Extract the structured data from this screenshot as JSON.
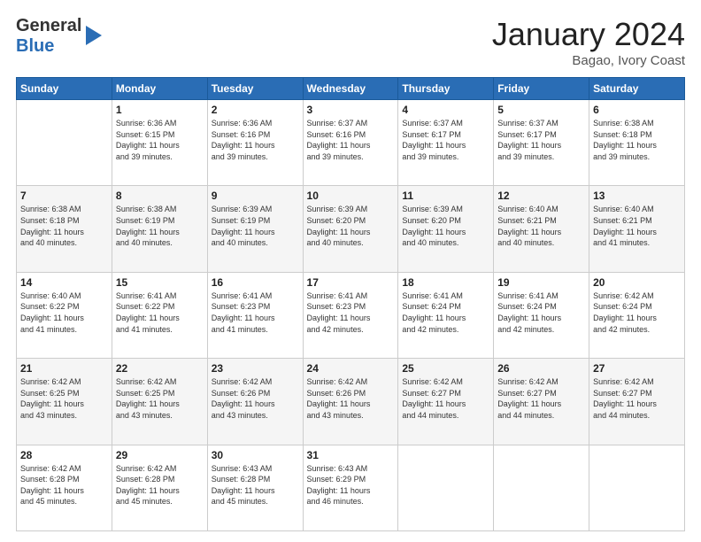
{
  "logo": {
    "line1": "General",
    "line2": "Blue"
  },
  "header": {
    "month": "January 2024",
    "location": "Bagao, Ivory Coast"
  },
  "weekdays": [
    "Sunday",
    "Monday",
    "Tuesday",
    "Wednesday",
    "Thursday",
    "Friday",
    "Saturday"
  ],
  "weeks": [
    [
      {
        "day": "",
        "info": ""
      },
      {
        "day": "1",
        "info": "Sunrise: 6:36 AM\nSunset: 6:15 PM\nDaylight: 11 hours\nand 39 minutes."
      },
      {
        "day": "2",
        "info": "Sunrise: 6:36 AM\nSunset: 6:16 PM\nDaylight: 11 hours\nand 39 minutes."
      },
      {
        "day": "3",
        "info": "Sunrise: 6:37 AM\nSunset: 6:16 PM\nDaylight: 11 hours\nand 39 minutes."
      },
      {
        "day": "4",
        "info": "Sunrise: 6:37 AM\nSunset: 6:17 PM\nDaylight: 11 hours\nand 39 minutes."
      },
      {
        "day": "5",
        "info": "Sunrise: 6:37 AM\nSunset: 6:17 PM\nDaylight: 11 hours\nand 39 minutes."
      },
      {
        "day": "6",
        "info": "Sunrise: 6:38 AM\nSunset: 6:18 PM\nDaylight: 11 hours\nand 39 minutes."
      }
    ],
    [
      {
        "day": "7",
        "info": "Sunrise: 6:38 AM\nSunset: 6:18 PM\nDaylight: 11 hours\nand 40 minutes."
      },
      {
        "day": "8",
        "info": "Sunrise: 6:38 AM\nSunset: 6:19 PM\nDaylight: 11 hours\nand 40 minutes."
      },
      {
        "day": "9",
        "info": "Sunrise: 6:39 AM\nSunset: 6:19 PM\nDaylight: 11 hours\nand 40 minutes."
      },
      {
        "day": "10",
        "info": "Sunrise: 6:39 AM\nSunset: 6:20 PM\nDaylight: 11 hours\nand 40 minutes."
      },
      {
        "day": "11",
        "info": "Sunrise: 6:39 AM\nSunset: 6:20 PM\nDaylight: 11 hours\nand 40 minutes."
      },
      {
        "day": "12",
        "info": "Sunrise: 6:40 AM\nSunset: 6:21 PM\nDaylight: 11 hours\nand 40 minutes."
      },
      {
        "day": "13",
        "info": "Sunrise: 6:40 AM\nSunset: 6:21 PM\nDaylight: 11 hours\nand 41 minutes."
      }
    ],
    [
      {
        "day": "14",
        "info": "Sunrise: 6:40 AM\nSunset: 6:22 PM\nDaylight: 11 hours\nand 41 minutes."
      },
      {
        "day": "15",
        "info": "Sunrise: 6:41 AM\nSunset: 6:22 PM\nDaylight: 11 hours\nand 41 minutes."
      },
      {
        "day": "16",
        "info": "Sunrise: 6:41 AM\nSunset: 6:23 PM\nDaylight: 11 hours\nand 41 minutes."
      },
      {
        "day": "17",
        "info": "Sunrise: 6:41 AM\nSunset: 6:23 PM\nDaylight: 11 hours\nand 42 minutes."
      },
      {
        "day": "18",
        "info": "Sunrise: 6:41 AM\nSunset: 6:24 PM\nDaylight: 11 hours\nand 42 minutes."
      },
      {
        "day": "19",
        "info": "Sunrise: 6:41 AM\nSunset: 6:24 PM\nDaylight: 11 hours\nand 42 minutes."
      },
      {
        "day": "20",
        "info": "Sunrise: 6:42 AM\nSunset: 6:24 PM\nDaylight: 11 hours\nand 42 minutes."
      }
    ],
    [
      {
        "day": "21",
        "info": "Sunrise: 6:42 AM\nSunset: 6:25 PM\nDaylight: 11 hours\nand 43 minutes."
      },
      {
        "day": "22",
        "info": "Sunrise: 6:42 AM\nSunset: 6:25 PM\nDaylight: 11 hours\nand 43 minutes."
      },
      {
        "day": "23",
        "info": "Sunrise: 6:42 AM\nSunset: 6:26 PM\nDaylight: 11 hours\nand 43 minutes."
      },
      {
        "day": "24",
        "info": "Sunrise: 6:42 AM\nSunset: 6:26 PM\nDaylight: 11 hours\nand 43 minutes."
      },
      {
        "day": "25",
        "info": "Sunrise: 6:42 AM\nSunset: 6:27 PM\nDaylight: 11 hours\nand 44 minutes."
      },
      {
        "day": "26",
        "info": "Sunrise: 6:42 AM\nSunset: 6:27 PM\nDaylight: 11 hours\nand 44 minutes."
      },
      {
        "day": "27",
        "info": "Sunrise: 6:42 AM\nSunset: 6:27 PM\nDaylight: 11 hours\nand 44 minutes."
      }
    ],
    [
      {
        "day": "28",
        "info": "Sunrise: 6:42 AM\nSunset: 6:28 PM\nDaylight: 11 hours\nand 45 minutes."
      },
      {
        "day": "29",
        "info": "Sunrise: 6:42 AM\nSunset: 6:28 PM\nDaylight: 11 hours\nand 45 minutes."
      },
      {
        "day": "30",
        "info": "Sunrise: 6:43 AM\nSunset: 6:28 PM\nDaylight: 11 hours\nand 45 minutes."
      },
      {
        "day": "31",
        "info": "Sunrise: 6:43 AM\nSunset: 6:29 PM\nDaylight: 11 hours\nand 46 minutes."
      },
      {
        "day": "",
        "info": ""
      },
      {
        "day": "",
        "info": ""
      },
      {
        "day": "",
        "info": ""
      }
    ]
  ]
}
